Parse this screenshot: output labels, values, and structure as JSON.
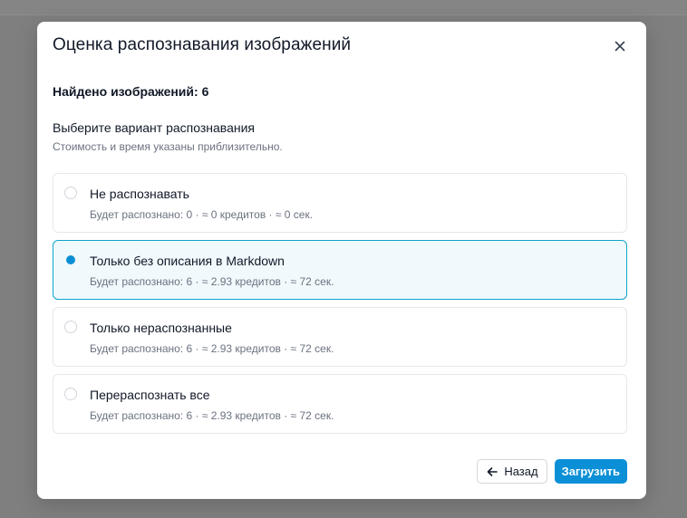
{
  "modal": {
    "title": "Оценка распознавания изображений",
    "found": "Найдено изображений: 6",
    "section_title": "Выберите вариант распознавания",
    "section_subtitle": "Стоимость и время указаны приблизительно.",
    "options": [
      {
        "label": "Не распознавать",
        "desc": "Будет распознано: 0 · ≈ 0 кредитов · ≈ 0 сек.",
        "selected": false
      },
      {
        "label": "Только без описания в Markdown",
        "desc": "Будет распознано: 6 · ≈ 2.93 кредитов · ≈ 72 сек.",
        "selected": true
      },
      {
        "label": "Только нераспознанные",
        "desc": "Будет распознано: 6 · ≈ 2.93 кредитов · ≈ 72 сек.",
        "selected": false
      },
      {
        "label": "Перераспознать все",
        "desc": "Будет распознано: 6 · ≈ 2.93 кредитов · ≈ 72 сек.",
        "selected": false
      }
    ],
    "back_label": "Назад",
    "upload_label": "Загрузить"
  },
  "icons": {
    "close": "close-icon",
    "back": "arrow-left-icon"
  },
  "colors": {
    "accent": "#0b8fd6",
    "selected_border": "#0ea5c9",
    "selected_bg": "#f0f9fc"
  }
}
